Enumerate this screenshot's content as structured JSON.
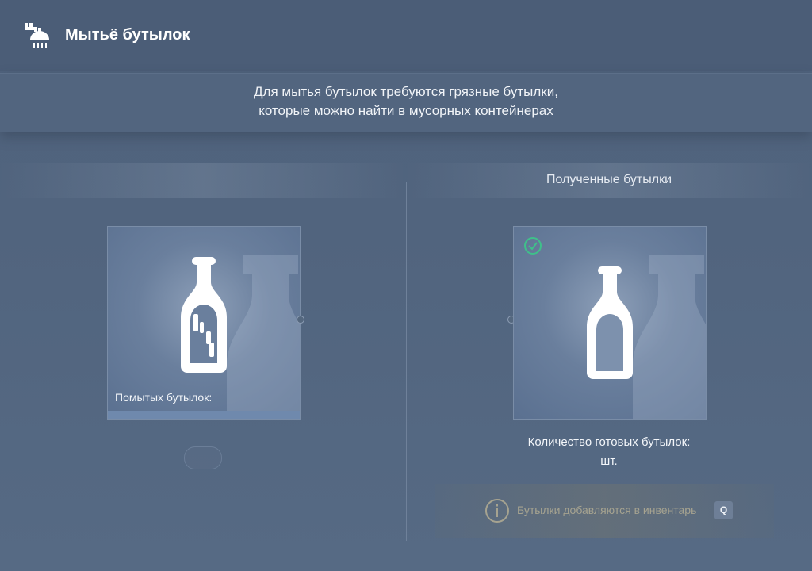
{
  "header": {
    "title": "Мытьё бутылок",
    "icon": "shower-icon"
  },
  "info": {
    "line1": "Для мытья бутылок требуются грязные бутылки,",
    "line2": "которые можно найти в мусорных контейнерах"
  },
  "left_panel": {
    "header_label": "",
    "caption": "Помытых бутылок:",
    "progress": 0,
    "icon": "dirty-bottle-icon"
  },
  "right_panel": {
    "header_label": "Полученные бутылки",
    "icon": "clean-bottle-icon",
    "status_icon": "check-circle-icon",
    "ready_label": "Количество готовых бутылок:",
    "ready_unit": "шт."
  },
  "hint": {
    "text": "Бутылки добавляются в инвентарь",
    "key": "Q",
    "icon": "info-icon"
  },
  "colors": {
    "accent_green": "#3fc08a",
    "hint_text": "#a6a390"
  }
}
